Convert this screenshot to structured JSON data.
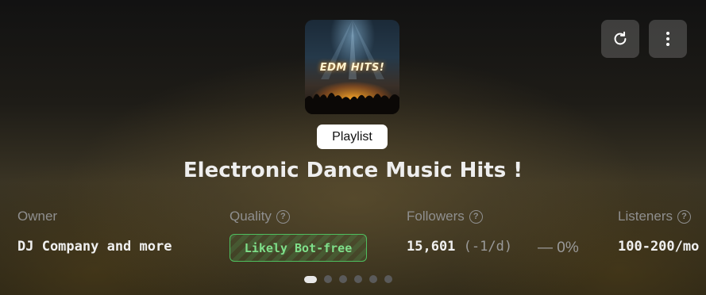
{
  "cover": {
    "text": "EDM HITS!"
  },
  "buttons": {
    "refresh": "refresh-icon",
    "more": "more-vertical-icon"
  },
  "playlist": {
    "type_label": "Playlist",
    "title": "Electronic Dance Music Hits !"
  },
  "stats": {
    "owner": {
      "label": "Owner",
      "value": "DJ Company and more"
    },
    "quality": {
      "label": "Quality",
      "value": "Likely Bot-free"
    },
    "followers": {
      "label": "Followers",
      "value": "15,601",
      "daily": "(-1/d)",
      "change": "— 0%"
    },
    "listeners": {
      "label": "Listeners",
      "value": "100-200/mo"
    }
  },
  "pager": {
    "pages": 6,
    "active": 1
  },
  "colors": {
    "quality_green": "#7fe08a",
    "badge_bg": "#ffffff"
  }
}
